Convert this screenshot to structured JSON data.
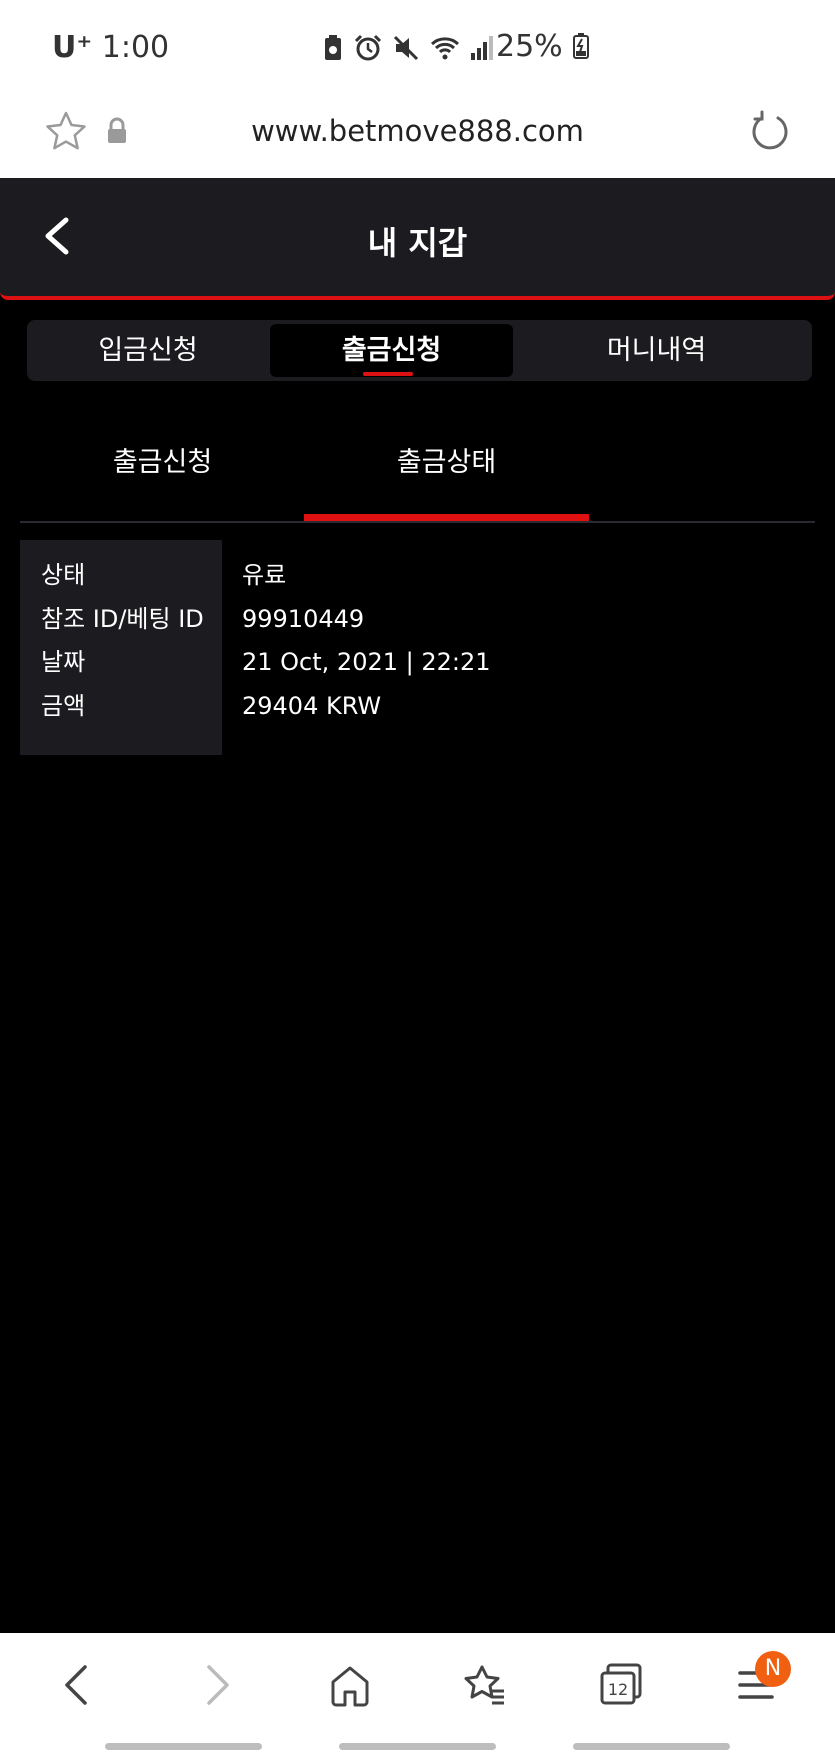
{
  "status_bar": {
    "carrier": "U⁺",
    "time": "1:00",
    "battery": "25%"
  },
  "browser": {
    "url": "www.betmove888.com",
    "tab_count": "12",
    "menu_badge": "N"
  },
  "header": {
    "title": "내 지갑"
  },
  "tabs": [
    {
      "label": "입금신청"
    },
    {
      "label": "출금신청"
    },
    {
      "label": "머니내역"
    }
  ],
  "active_tab": 1,
  "subtabs": [
    {
      "label": "출금신청"
    },
    {
      "label": "출금상태"
    }
  ],
  "active_subtab": 1,
  "details": [
    {
      "label": "상태",
      "value": "유료"
    },
    {
      "label": "참조 ID/베팅 ID",
      "value": "99910449"
    },
    {
      "label": "날짜",
      "value": "21 Oct, 2021 | 22:21"
    },
    {
      "label": "금액",
      "value": "29404 KRW"
    }
  ],
  "colors": {
    "accent": "#e01010",
    "panel": "#1c1c20",
    "background": "#000000",
    "badge": "#f06010"
  }
}
